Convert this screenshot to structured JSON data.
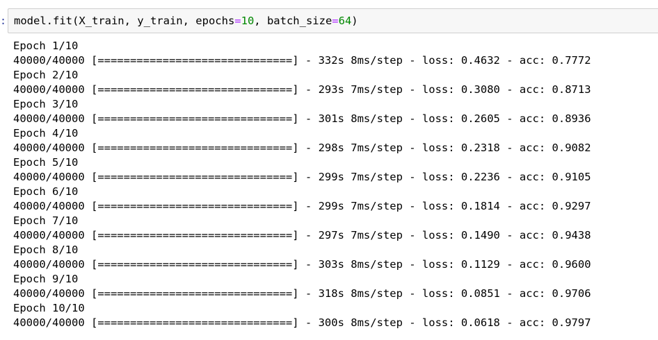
{
  "cell": {
    "prompt_marker": ":",
    "code_tokens": [
      {
        "text": "model.fit(X_train, y_train, epochs",
        "kind": "plain"
      },
      {
        "text": "=",
        "kind": "op"
      },
      {
        "text": "10",
        "kind": "num"
      },
      {
        "text": ", batch_size",
        "kind": "plain"
      },
      {
        "text": "=",
        "kind": "op"
      },
      {
        "text": "64",
        "kind": "num"
      },
      {
        "text": ")",
        "kind": "plain"
      }
    ]
  },
  "output": {
    "lines": [
      "Epoch 1/10",
      "40000/40000 [==============================] - 332s 8ms/step - loss: 0.4632 - acc: 0.7772",
      "Epoch 2/10",
      "40000/40000 [==============================] - 293s 7ms/step - loss: 0.3080 - acc: 0.8713",
      "Epoch 3/10",
      "40000/40000 [==============================] - 301s 8ms/step - loss: 0.2605 - acc: 0.8936",
      "Epoch 4/10",
      "40000/40000 [==============================] - 298s 7ms/step - loss: 0.2318 - acc: 0.9082",
      "Epoch 5/10",
      "40000/40000 [==============================] - 299s 7ms/step - loss: 0.2236 - acc: 0.9105",
      "Epoch 6/10",
      "40000/40000 [==============================] - 299s 7ms/step - loss: 0.1814 - acc: 0.9297",
      "Epoch 7/10",
      "40000/40000 [==============================] - 297s 7ms/step - loss: 0.1490 - acc: 0.9438",
      "Epoch 8/10",
      "40000/40000 [==============================] - 303s 8ms/step - loss: 0.1129 - acc: 0.9600",
      "Epoch 9/10",
      "40000/40000 [==============================] - 318s 8ms/step - loss: 0.0851 - acc: 0.9706",
      "Epoch 10/10",
      "40000/40000 [==============================] - 300s 8ms/step - loss: 0.0618 - acc: 0.9797"
    ]
  },
  "colors": {
    "input_background": "#f7f7f7",
    "input_border": "#cfcfcf",
    "number_token": "#008800",
    "operator_token": "#aa22ff",
    "prompt": "#303f9f"
  }
}
